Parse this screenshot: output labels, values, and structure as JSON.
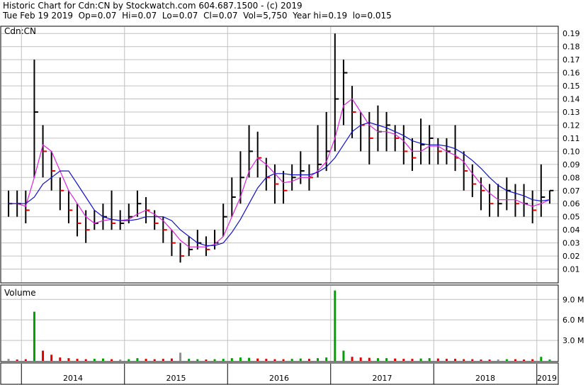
{
  "header": {
    "line1": "Historic Chart for Cdn:CN by Stockwatch.com 604.687.1500 - (c) 2019",
    "line2": "Tue Feb 19 2019  Op=0.07  Hi=0.07  Lo=0.07  Cl=0.07  Vol=5,750  Year hi=0.19  lo=0.015"
  },
  "price_panel": {
    "label": "Cdn:CN"
  },
  "volume_panel": {
    "label": "Volume"
  },
  "colors": {
    "bar": "#000000",
    "down_tick": "#e00000",
    "ma_fast": "#e020e0",
    "ma_slow": "#1010c8",
    "vol_up": "#00a000",
    "vol_down": "#e00000",
    "vol_neutral": "#909090",
    "grid": "#c0c0c0"
  },
  "chart_data": [
    {
      "type": "line",
      "title": "Cdn:CN",
      "ylim": [
        0,
        0.195
      ],
      "y_ticks": [
        "0.19",
        "0.18",
        "0.17",
        "0.16",
        "0.15",
        "0.14",
        "0.13",
        "0.12",
        "0.11",
        "0.10",
        "0.09",
        "0.08",
        "0.07",
        "0.06",
        "0.05",
        "0.04",
        "0.03",
        "0.02",
        "0.01"
      ],
      "x_labels": [
        "2014",
        "2015",
        "2016",
        "2017",
        "2018",
        "2019"
      ],
      "series": [
        {
          "kind": "close",
          "x": [
            "2013-11",
            "2013-12",
            "2014-01",
            "2014-02",
            "2014-03",
            "2014-04",
            "2014-05",
            "2014-06",
            "2014-07",
            "2014-08",
            "2014-09",
            "2014-10",
            "2014-11",
            "2014-12",
            "2015-01",
            "2015-02",
            "2015-03",
            "2015-04",
            "2015-05",
            "2015-06",
            "2015-07",
            "2015-08",
            "2015-09",
            "2015-10",
            "2015-11",
            "2015-12",
            "2016-01",
            "2016-02",
            "2016-03",
            "2016-04",
            "2016-05",
            "2016-06",
            "2016-07",
            "2016-08",
            "2016-09",
            "2016-10",
            "2016-11",
            "2016-12",
            "2017-01",
            "2017-02",
            "2017-03",
            "2017-04",
            "2017-05",
            "2017-06",
            "2017-07",
            "2017-08",
            "2017-09",
            "2017-10",
            "2017-11",
            "2017-12",
            "2018-01",
            "2018-02",
            "2018-03",
            "2018-04",
            "2018-05",
            "2018-06",
            "2018-07",
            "2018-08",
            "2018-09",
            "2018-10",
            "2018-11",
            "2018-12",
            "2019-01",
            "2019-02"
          ],
          "values": [
            0.06,
            0.06,
            0.055,
            0.13,
            0.1,
            0.085,
            0.07,
            0.055,
            0.045,
            0.04,
            0.045,
            0.05,
            0.045,
            0.045,
            0.05,
            0.06,
            0.055,
            0.045,
            0.04,
            0.03,
            0.02,
            0.025,
            0.03,
            0.025,
            0.03,
            0.05,
            0.065,
            0.08,
            0.1,
            0.095,
            0.08,
            0.075,
            0.07,
            0.08,
            0.085,
            0.08,
            0.09,
            0.1,
            0.14,
            0.16,
            0.13,
            0.12,
            0.11,
            0.115,
            0.12,
            0.11,
            0.1,
            0.095,
            0.105,
            0.11,
            0.1,
            0.1,
            0.095,
            0.085,
            0.075,
            0.07,
            0.06,
            0.06,
            0.07,
            0.06,
            0.06,
            0.055,
            0.065,
            0.07
          ]
        },
        {
          "kind": "high",
          "values": [
            0.07,
            0.07,
            0.07,
            0.17,
            0.12,
            0.1,
            0.08,
            0.07,
            0.06,
            0.055,
            0.055,
            0.06,
            0.07,
            0.055,
            0.06,
            0.07,
            0.065,
            0.055,
            0.05,
            0.04,
            0.03,
            0.035,
            0.04,
            0.035,
            0.04,
            0.06,
            0.08,
            0.1,
            0.12,
            0.115,
            0.095,
            0.09,
            0.085,
            0.09,
            0.1,
            0.09,
            0.12,
            0.13,
            0.19,
            0.17,
            0.15,
            0.13,
            0.13,
            0.135,
            0.13,
            0.12,
            0.12,
            0.11,
            0.125,
            0.12,
            0.11,
            0.11,
            0.12,
            0.1,
            0.09,
            0.08,
            0.075,
            0.075,
            0.08,
            0.075,
            0.075,
            0.07,
            0.09,
            0.07
          ]
        },
        {
          "kind": "low",
          "values": [
            0.05,
            0.05,
            0.045,
            0.08,
            0.08,
            0.07,
            0.055,
            0.045,
            0.035,
            0.03,
            0.04,
            0.04,
            0.04,
            0.04,
            0.045,
            0.05,
            0.045,
            0.04,
            0.03,
            0.02,
            0.015,
            0.02,
            0.025,
            0.02,
            0.025,
            0.035,
            0.05,
            0.06,
            0.08,
            0.08,
            0.07,
            0.06,
            0.06,
            0.07,
            0.075,
            0.07,
            0.08,
            0.085,
            0.1,
            0.12,
            0.11,
            0.1,
            0.09,
            0.1,
            0.1,
            0.1,
            0.09,
            0.085,
            0.09,
            0.09,
            0.09,
            0.09,
            0.085,
            0.07,
            0.065,
            0.055,
            0.05,
            0.05,
            0.055,
            0.05,
            0.05,
            0.045,
            0.05,
            0.06
          ]
        },
        {
          "name": "",
          "kind": "ma_fast",
          "values": [
            0.06,
            0.06,
            0.058,
            0.08,
            0.105,
            0.1,
            0.085,
            0.07,
            0.06,
            0.05,
            0.045,
            0.047,
            0.048,
            0.047,
            0.048,
            0.052,
            0.055,
            0.052,
            0.047,
            0.04,
            0.032,
            0.027,
            0.027,
            0.027,
            0.029,
            0.035,
            0.05,
            0.065,
            0.085,
            0.095,
            0.09,
            0.083,
            0.076,
            0.077,
            0.08,
            0.08,
            0.085,
            0.092,
            0.11,
            0.135,
            0.14,
            0.13,
            0.12,
            0.115,
            0.115,
            0.113,
            0.108,
            0.1,
            0.1,
            0.104,
            0.104,
            0.1,
            0.097,
            0.092,
            0.083,
            0.075,
            0.068,
            0.063,
            0.063,
            0.063,
            0.06,
            0.058,
            0.06,
            0.063
          ]
        },
        {
          "name": "",
          "kind": "ma_slow",
          "values": [
            0.06,
            0.06,
            0.06,
            0.065,
            0.075,
            0.08,
            0.085,
            0.085,
            0.075,
            0.065,
            0.055,
            0.05,
            0.048,
            0.047,
            0.047,
            0.048,
            0.05,
            0.05,
            0.05,
            0.047,
            0.04,
            0.035,
            0.03,
            0.028,
            0.028,
            0.03,
            0.038,
            0.048,
            0.06,
            0.072,
            0.08,
            0.083,
            0.083,
            0.082,
            0.082,
            0.082,
            0.084,
            0.088,
            0.095,
            0.105,
            0.115,
            0.12,
            0.122,
            0.12,
            0.118,
            0.115,
            0.112,
            0.108,
            0.106,
            0.105,
            0.105,
            0.104,
            0.102,
            0.098,
            0.093,
            0.087,
            0.08,
            0.074,
            0.07,
            0.068,
            0.066,
            0.063,
            0.062,
            0.063
          ]
        }
      ]
    },
    {
      "type": "bar",
      "title": "Volume",
      "ylim": [
        0,
        11000000
      ],
      "y_ticks": [
        "9.0 M",
        "6.0 M",
        "3.0 M"
      ],
      "x": [
        "2013-11",
        "2013-12",
        "2014-01",
        "2014-02",
        "2014-03",
        "2014-04",
        "2014-05",
        "2014-06",
        "2014-07",
        "2014-08",
        "2014-09",
        "2014-10",
        "2014-11",
        "2014-12",
        "2015-01",
        "2015-02",
        "2015-03",
        "2015-04",
        "2015-05",
        "2015-06",
        "2015-07",
        "2015-08",
        "2015-09",
        "2015-10",
        "2015-11",
        "2015-12",
        "2016-01",
        "2016-02",
        "2016-03",
        "2016-04",
        "2016-05",
        "2016-06",
        "2016-07",
        "2016-08",
        "2016-09",
        "2016-10",
        "2016-11",
        "2016-12",
        "2017-01",
        "2017-02",
        "2017-03",
        "2017-04",
        "2017-05",
        "2017-06",
        "2017-07",
        "2017-08",
        "2017-09",
        "2017-10",
        "2017-11",
        "2017-12",
        "2018-01",
        "2018-02",
        "2018-03",
        "2018-04",
        "2018-05",
        "2018-06",
        "2018-07",
        "2018-08",
        "2018-09",
        "2018-10",
        "2018-11",
        "2018-12",
        "2019-01",
        "2019-02"
      ],
      "values": [
        300000,
        200000,
        250000,
        7200000,
        1500000,
        900000,
        500000,
        400000,
        300000,
        250000,
        300000,
        350000,
        250000,
        200000,
        250000,
        400000,
        300000,
        250000,
        300000,
        350000,
        1200000,
        300000,
        250000,
        200000,
        250000,
        300000,
        400000,
        500000,
        450000,
        350000,
        300000,
        250000,
        250000,
        300000,
        350000,
        300000,
        400000,
        500000,
        10300000,
        1500000,
        600000,
        500000,
        450000,
        400000,
        400000,
        350000,
        300000,
        300000,
        350000,
        400000,
        350000,
        300000,
        300000,
        250000,
        250000,
        200000,
        200000,
        200000,
        250000,
        250000,
        200000,
        250000,
        600000,
        200000
      ],
      "direction": [
        "n",
        "d",
        "d",
        "u",
        "d",
        "d",
        "d",
        "d",
        "d",
        "d",
        "u",
        "u",
        "d",
        "n",
        "u",
        "u",
        "d",
        "d",
        "d",
        "d",
        "n",
        "u",
        "u",
        "d",
        "u",
        "u",
        "u",
        "u",
        "u",
        "d",
        "d",
        "d",
        "d",
        "u",
        "u",
        "d",
        "u",
        "u",
        "u",
        "u",
        "d",
        "d",
        "d",
        "u",
        "u",
        "d",
        "d",
        "d",
        "u",
        "u",
        "d",
        "d",
        "d",
        "d",
        "d",
        "d",
        "d",
        "n",
        "u",
        "d",
        "d",
        "d",
        "u",
        "u"
      ]
    }
  ]
}
